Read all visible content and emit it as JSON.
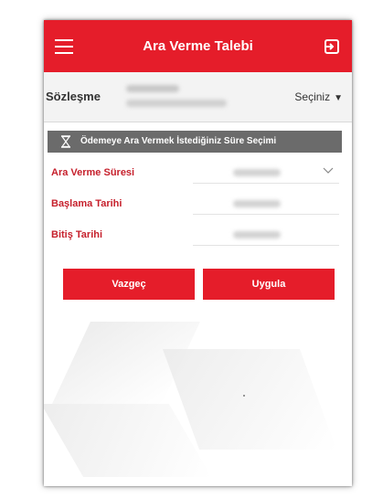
{
  "header": {
    "title": "Ara Verme Talebi",
    "menu_icon": "hamburger-menu-icon",
    "logout_icon": "logout-icon",
    "background_color": "#e51d2a"
  },
  "contract": {
    "label": "Sözleşme",
    "select_label": "Seçiniz"
  },
  "section": {
    "title": "Ödemeye Ara Vermek İstediğiniz Süre Seçimi",
    "icon": "hourglass-icon"
  },
  "form": {
    "rows": [
      {
        "label": "Ara Verme Süresi",
        "has_dropdown": true
      },
      {
        "label": "Başlama Tarihi",
        "has_dropdown": false
      },
      {
        "label": "Bitiş Tarihi",
        "has_dropdown": false
      }
    ]
  },
  "actions": {
    "cancel_label": "Vazgeç",
    "apply_label": "Uygula"
  },
  "colors": {
    "accent": "#e51d2a",
    "label_red": "#c6202c",
    "section_gray": "#6b6b6b"
  }
}
